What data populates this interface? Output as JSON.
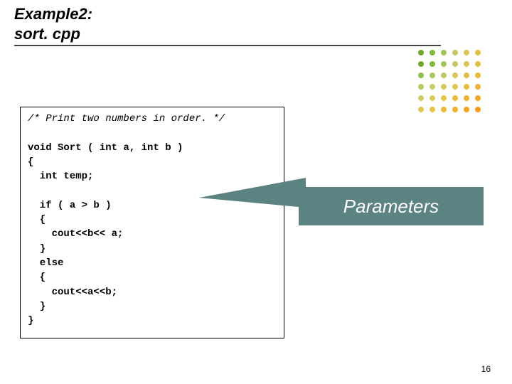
{
  "title": {
    "line1": "Example2:",
    "line2": "sort. cpp"
  },
  "code": {
    "comment": "/* Print two numbers in order. */",
    "decl_void_sort": "void Sort (",
    "params": " int a, int b ",
    "decl_close": ")",
    "brace_open": "{",
    "int_temp": "  int temp;",
    "blank": "",
    "if_line": "  if ( a > b )",
    "if_open": "  {",
    "cout_ba": "    cout<<b<< a;",
    "if_close": "  }",
    "else_line": "  else",
    "else_open": "  {",
    "cout_ab": "    cout<<a<<b;",
    "else_close": "  }",
    "brace_close": "}"
  },
  "callout": {
    "label": "Parameters"
  },
  "dots": {
    "palette": [
      "#6ea929",
      "#7eb93a",
      "#9cc25a",
      "#c6c66c",
      "#d8c45a",
      "#e0c14a",
      "#6ea929",
      "#7eb93a",
      "#9cc25a",
      "#c6c66c",
      "#d8c45a",
      "#e0c14a",
      "#8fbf4f",
      "#a7c95e",
      "#bfc96a",
      "#d6c560",
      "#e0c050",
      "#e6bb40",
      "#b0cc63",
      "#c4cf68",
      "#d4cb60",
      "#e0c654",
      "#e8bd44",
      "#ecb335",
      "#cfce66",
      "#dacb5d",
      "#e3c650",
      "#e9bd42",
      "#eeb234",
      "#f1a827",
      "#e0c858",
      "#e6c14c",
      "#ebb93e",
      "#efb030",
      "#f3a624",
      "#f69b18"
    ]
  },
  "page_number": "16"
}
